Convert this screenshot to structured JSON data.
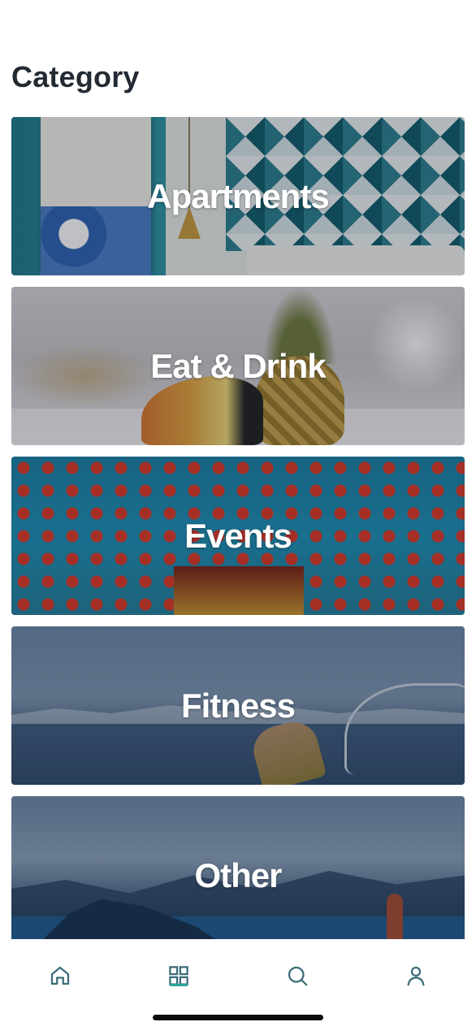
{
  "page": {
    "title": "Category"
  },
  "categories": [
    {
      "label": "Apartments"
    },
    {
      "label": "Eat & Drink"
    },
    {
      "label": "Events"
    },
    {
      "label": "Fitness"
    },
    {
      "label": "Other"
    }
  ],
  "tabbar": {
    "items": [
      {
        "icon": "home-icon",
        "active": false
      },
      {
        "icon": "grid-icon",
        "active": true
      },
      {
        "icon": "search-icon",
        "active": false
      },
      {
        "icon": "profile-icon",
        "active": false
      }
    ],
    "icon_color": "#3a6b78",
    "active_color": "#2aa79b"
  }
}
